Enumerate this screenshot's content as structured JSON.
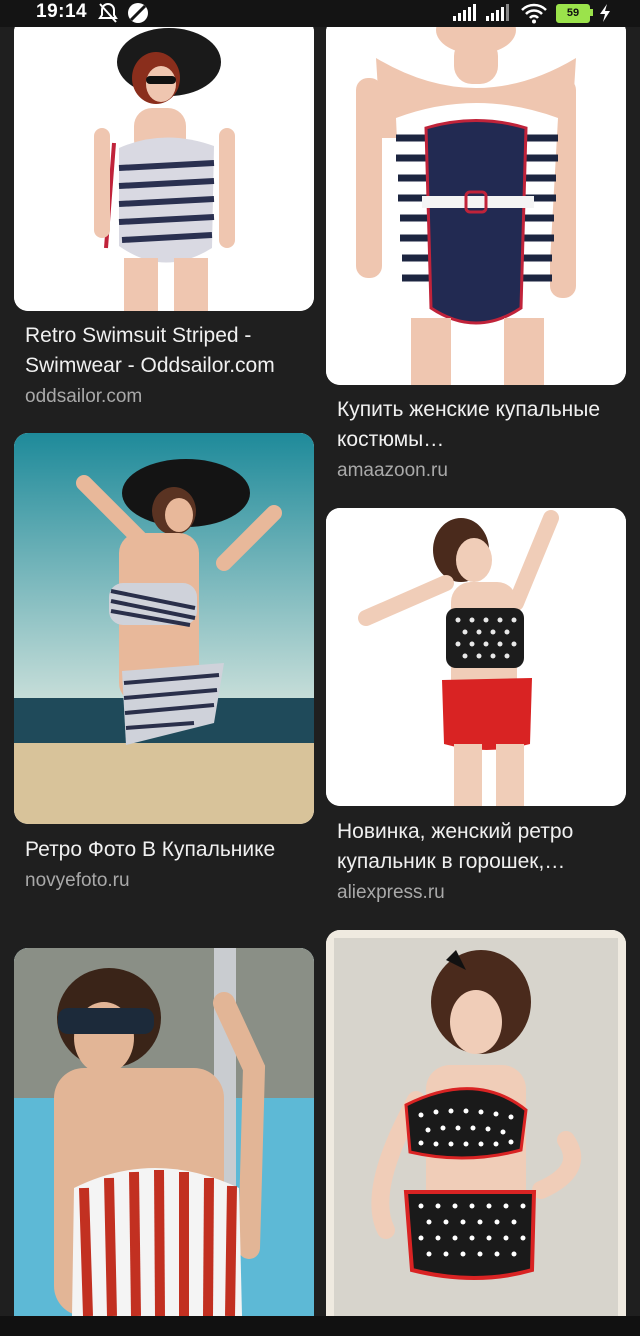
{
  "status_bar": {
    "time": "19:14",
    "icons": [
      "alarm-off-icon",
      "do-not-disturb-icon",
      "signal-icon",
      "signal-icon",
      "wifi-icon",
      "battery-icon",
      "charging-icon"
    ],
    "battery_level": "59"
  },
  "results": [
    {
      "title": "Retro Swimsuit Striped - Swimwear - Oddsailor.com",
      "source": "oddsailor.com"
    },
    {
      "title": "Купить женские купальные костюмы…",
      "source": "amaazoon.ru"
    },
    {
      "title": "Ретро Фото В Купальнике",
      "source": "novyefoto.ru"
    },
    {
      "title": "Новинка, женский ретро купальник в горошек,…",
      "source": "aliexpress.ru"
    },
    {
      "title": "",
      "source": ""
    },
    {
      "title": "",
      "source": ""
    }
  ],
  "colors": {
    "background": "#1f1f1f",
    "caption_title": "#f0f0f0",
    "caption_source": "#a9a9a9",
    "battery": "#9be34b"
  }
}
